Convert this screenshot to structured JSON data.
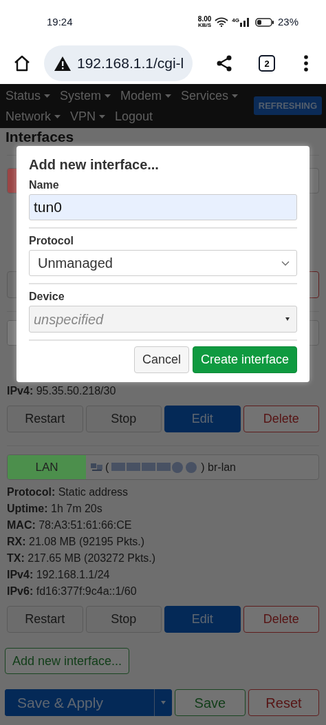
{
  "status_bar": {
    "time": "19:24",
    "net_speed": "8.00",
    "net_speed_unit": "KB/S",
    "network_type": "4G",
    "battery": "23%"
  },
  "browser": {
    "url": "192.168.1.1/cgi-l",
    "tab_count": "2"
  },
  "nav": {
    "items": [
      {
        "label": "Status",
        "has_menu": true
      },
      {
        "label": "System",
        "has_menu": true
      },
      {
        "label": "Modem",
        "has_menu": true
      },
      {
        "label": "Services",
        "has_menu": true
      },
      {
        "label": "Network",
        "has_menu": true
      },
      {
        "label": "VPN",
        "has_menu": true
      },
      {
        "label": "Logout",
        "has_menu": false
      }
    ],
    "badge": "REFRESHING"
  },
  "page": {
    "title": "Interfaces",
    "interfaces": [
      {
        "kind": "covered",
        "color": "#9b4545"
      },
      {
        "kind": "partial",
        "color": "#7a7a7a",
        "details": [
          {
            "label": "IPv4:",
            "value": "95.35.50.218/30"
          }
        ],
        "buttons": [
          {
            "label": "Restart",
            "kind": "default"
          },
          {
            "label": "Stop",
            "kind": "default"
          },
          {
            "label": "Edit",
            "kind": "primary"
          },
          {
            "label": "Delete",
            "kind": "negative"
          }
        ]
      },
      {
        "kind": "full",
        "name": "LAN",
        "color": "#4c8f4c",
        "device_open": "(",
        "device_close": ")",
        "device": "br-lan",
        "details": [
          {
            "label": "Protocol:",
            "value": "Static address"
          },
          {
            "label": "Uptime:",
            "value": "1h 7m 20s"
          },
          {
            "label": "MAC:",
            "value": "78:A3:51:61:66:CE"
          },
          {
            "label": "RX:",
            "value": "21.08 MB (92195 Pkts.)"
          },
          {
            "label": "TX:",
            "value": "217.65 MB (203272 Pkts.)"
          },
          {
            "label": "IPv4:",
            "value": "192.168.1.1/24"
          },
          {
            "label": "IPv6:",
            "value": "fd16:377f:9c4a::1/60"
          }
        ],
        "buttons": [
          {
            "label": "Restart",
            "kind": "default"
          },
          {
            "label": "Stop",
            "kind": "default"
          },
          {
            "label": "Edit",
            "kind": "primary"
          },
          {
            "label": "Delete",
            "kind": "negative"
          }
        ]
      }
    ],
    "add_button": "Add new interface...",
    "actions": [
      {
        "label": "Save & Apply",
        "kind": "primary"
      },
      {
        "label": "Save",
        "kind": "positive"
      },
      {
        "label": "Reset",
        "kind": "negative"
      }
    ]
  },
  "dialog": {
    "title": "Add new interface...",
    "fields": [
      {
        "label": "Name",
        "kind": "text",
        "value": "tun0"
      },
      {
        "label": "Protocol",
        "kind": "select",
        "value": "Unmanaged"
      },
      {
        "label": "Device",
        "kind": "combo",
        "placeholder": "unspecified"
      }
    ],
    "buttons": [
      {
        "label": "Cancel",
        "kind": "default"
      },
      {
        "label": "Create interface",
        "kind": "positive"
      }
    ]
  }
}
